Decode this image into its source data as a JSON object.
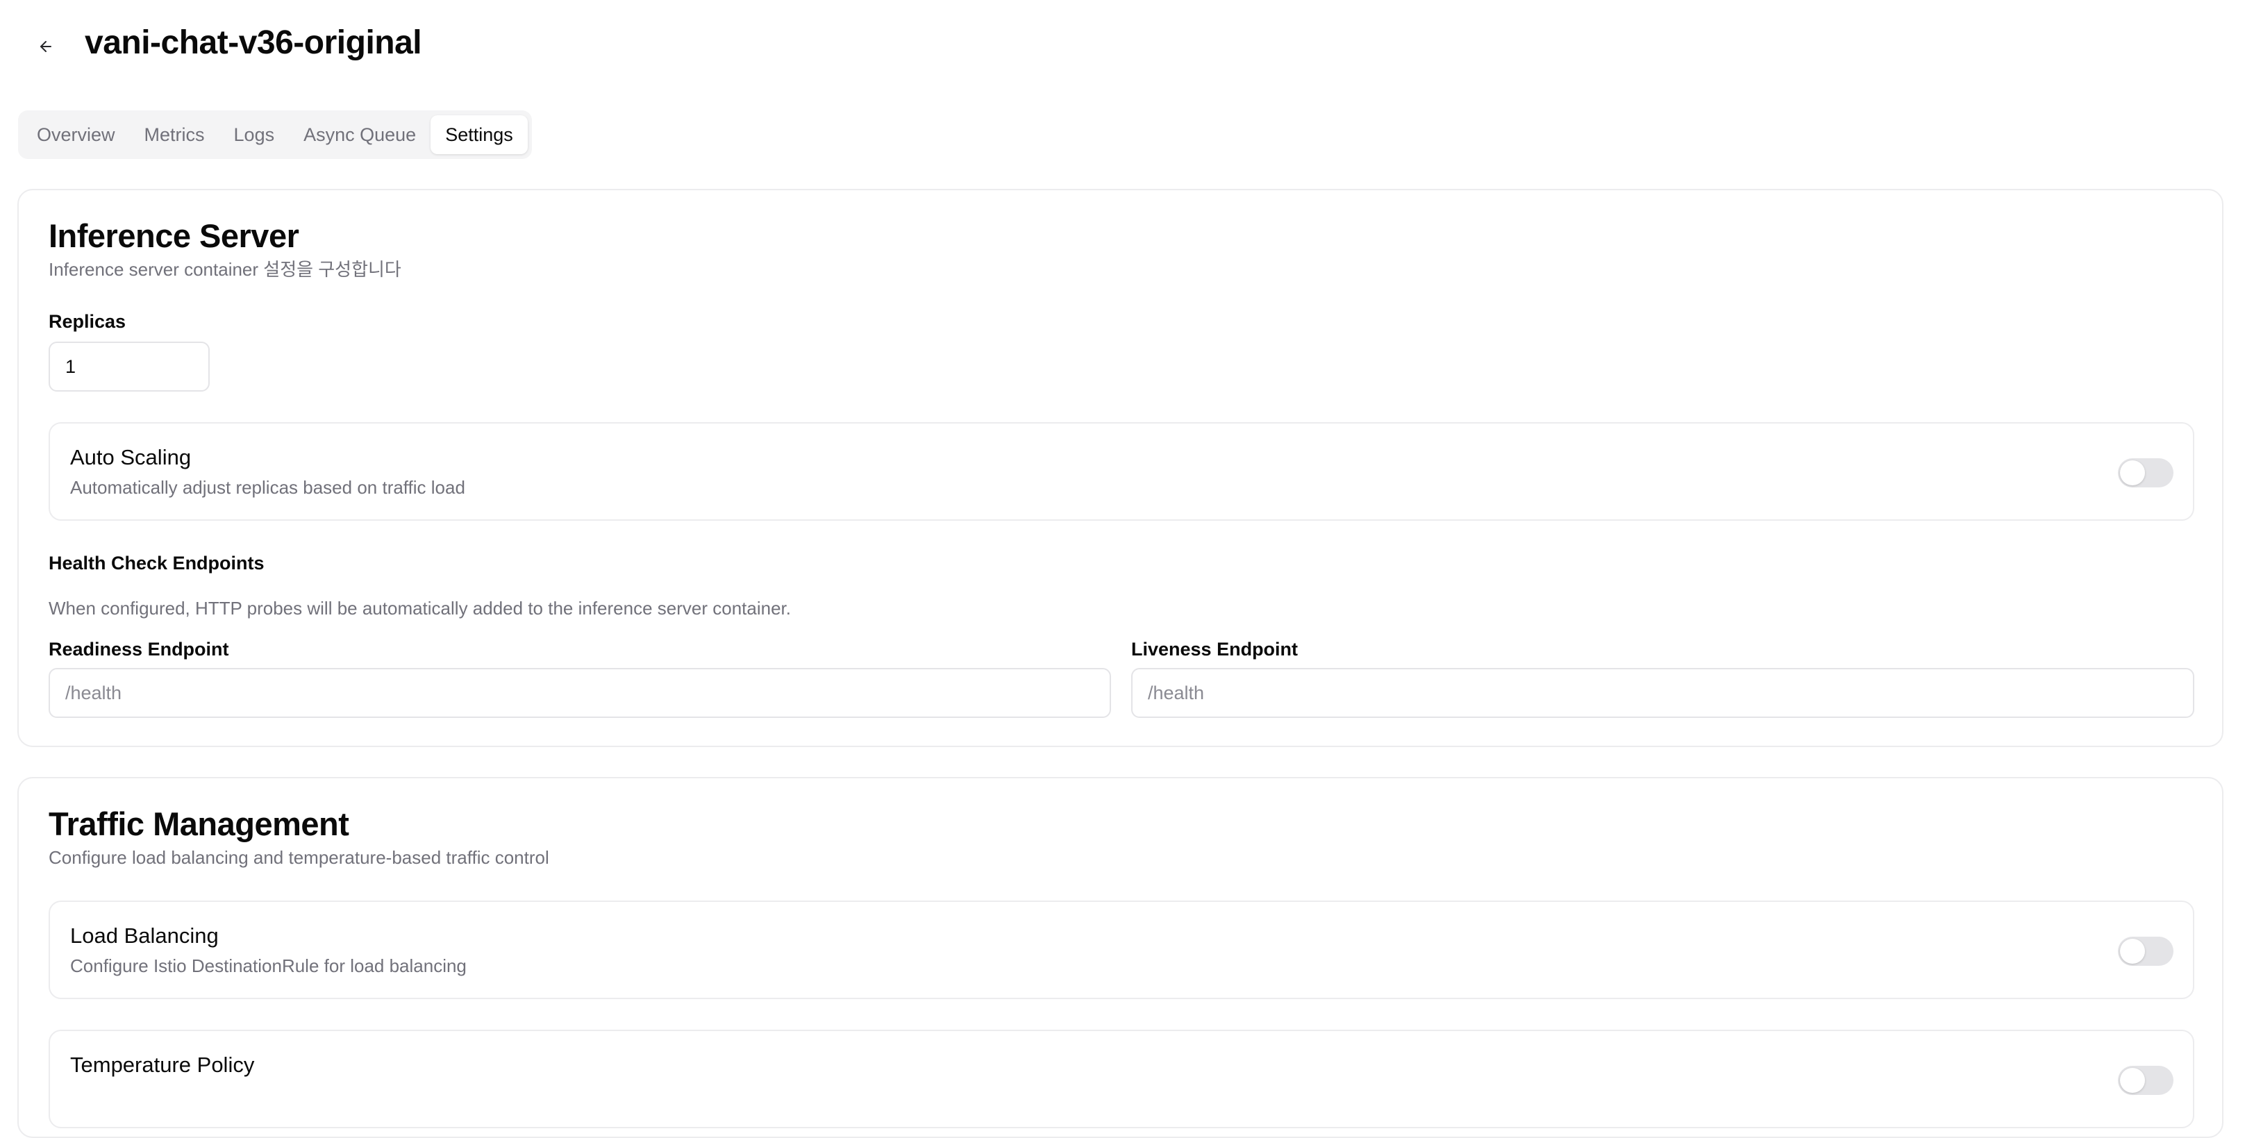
{
  "header": {
    "title": "vani-chat-v36-original",
    "back_icon": "arrow-left-icon"
  },
  "tabs": [
    {
      "label": "Overview",
      "active": false
    },
    {
      "label": "Metrics",
      "active": false
    },
    {
      "label": "Logs",
      "active": false
    },
    {
      "label": "Async Queue",
      "active": false
    },
    {
      "label": "Settings",
      "active": true
    }
  ],
  "inference_server": {
    "title": "Inference Server",
    "description": "Inference server container 설정을 구성합니다",
    "replicas": {
      "label": "Replicas",
      "value": "1"
    },
    "auto_scaling": {
      "title": "Auto Scaling",
      "description": "Automatically adjust replicas based on traffic load",
      "enabled": false
    },
    "health_check": {
      "label": "Health Check Endpoints",
      "description": "When configured, HTTP probes will be automatically added to the inference server container.",
      "readiness": {
        "label": "Readiness Endpoint",
        "placeholder": "/health",
        "value": ""
      },
      "liveness": {
        "label": "Liveness Endpoint",
        "placeholder": "/health",
        "value": ""
      }
    }
  },
  "traffic_management": {
    "title": "Traffic Management",
    "description": "Configure load balancing and temperature-based traffic control",
    "load_balancing": {
      "title": "Load Balancing",
      "description": "Configure Istio DestinationRule for load balancing",
      "enabled": false
    },
    "temperature_policy": {
      "title": "Temperature Policy",
      "enabled": false
    }
  },
  "colors": {
    "accent_text": "#0a0a0a",
    "muted_text": "#71717a",
    "border": "#e4e4e7",
    "switch_off": "#e4e4e7",
    "tab_bar_bg": "#f4f4f5"
  }
}
